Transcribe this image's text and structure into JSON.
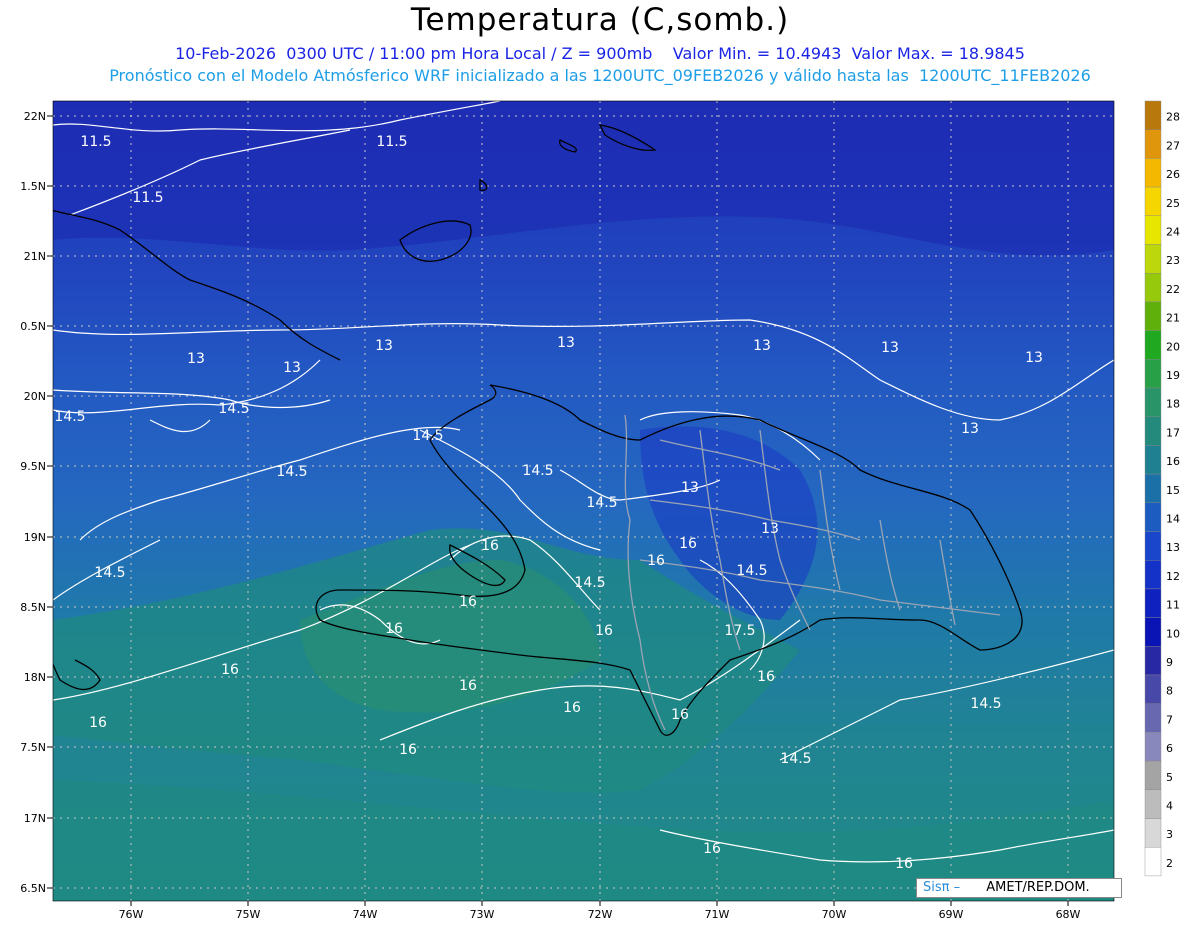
{
  "header": {
    "title": "Temperatura (C,somb.)",
    "line1": "10-Feb-2026  0300 UTC / 11:00 pm Hora Local / Z = 900mb    Valor Min. = 10.4943  Valor Max. = 18.9845",
    "line2": "Pronóstico con el Modelo Atmósferico WRF inicializado a las 1200UTC_09FEB2026 y válido hasta las  1200UTC_11FEB2026"
  },
  "axes": {
    "lat_labels": [
      "22N",
      "1.5N",
      "21N",
      "0.5N",
      "20N",
      "9.5N",
      "19N",
      "8.5N",
      "18N",
      "7.5N",
      "17N",
      "6.5N"
    ],
    "lon_labels": [
      "76W",
      "75W",
      "74W",
      "73W",
      "72W",
      "71W",
      "70W",
      "69W",
      "68W"
    ]
  },
  "colorbar": {
    "labels": [
      "28",
      "27",
      "26",
      "25",
      "24",
      "23",
      "22",
      "21",
      "20",
      "19",
      "18",
      "17",
      "16",
      "15",
      "14",
      "13",
      "12",
      "11",
      "10",
      "9",
      "8",
      "7",
      "6",
      "5",
      "4",
      "3",
      "2"
    ],
    "colors": [
      "#b8780c",
      "#e0960c",
      "#f5b800",
      "#f5d600",
      "#e6e600",
      "#bcd80c",
      "#96c80c",
      "#60b00c",
      "#20a820",
      "#28a048",
      "#289468",
      "#248a7c",
      "#1e8090",
      "#1c70a8",
      "#1c5cc0",
      "#1a46cc",
      "#1432c8",
      "#0f22c0",
      "#0a14b4",
      "#2828a4",
      "#4848a8",
      "#6868b0",
      "#8888bc",
      "#a4a4a4",
      "#bcbcbc",
      "#d8d8d8",
      "#ffffff"
    ]
  },
  "contour_labels": [
    "11.5",
    "11.5",
    "11.5",
    "13",
    "13",
    "13",
    "13",
    "13",
    "13",
    "13",
    "13",
    "14.5",
    "14.5",
    "14.5",
    "14.5",
    "14.5",
    "14.5",
    "14.5",
    "14.5",
    "14.5",
    "14.5",
    "14.5",
    "16",
    "16",
    "16",
    "16",
    "16",
    "16",
    "16",
    "16",
    "16",
    "16",
    "16",
    "16",
    "16",
    "16",
    "16",
    "17.5",
    "13",
    "13"
  ],
  "credit": {
    "brand": "Sisπ –",
    "org": "AMET/REP.DOM."
  }
}
